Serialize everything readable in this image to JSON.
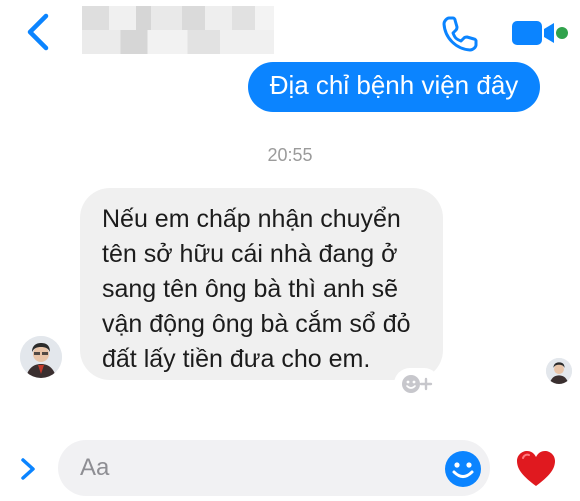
{
  "header": {
    "back_icon": "chevron-left-icon",
    "call_icon": "phone-icon",
    "video_icon": "video-camera-icon",
    "accent_color": "#0b84ff",
    "online_color": "#31a24c"
  },
  "messages": {
    "sent": {
      "text": "Địa chỉ bệnh viện đây"
    },
    "timestamp": "20:55",
    "received": {
      "lines": [
        "Nếu em chấp nhận chuyển",
        "tên sở hữu cái nhà đang ở",
        "sang tên ông bà thì anh sẽ",
        "vận động ông bà cắm sổ đỏ",
        "đất lấy tiền đưa cho em."
      ]
    }
  },
  "composer": {
    "placeholder": "Aa",
    "value": "",
    "expand_icon": "chevron-right-icon",
    "emoji_icon": "smiley-icon",
    "like_icon": "heart-icon",
    "heart_color": "#e0191f"
  }
}
